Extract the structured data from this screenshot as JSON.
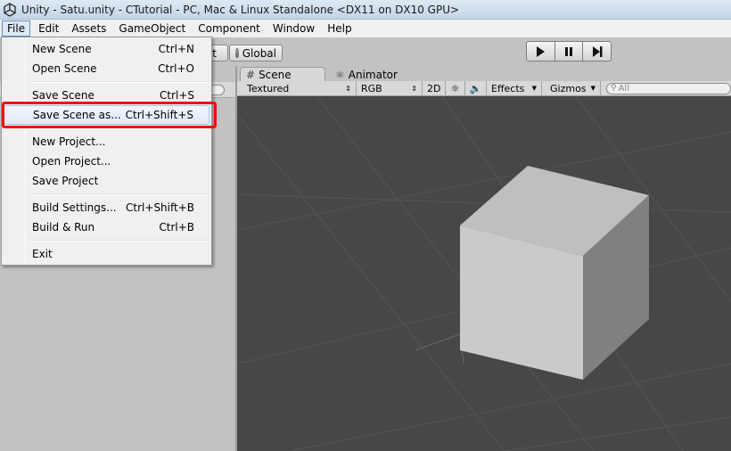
{
  "window": {
    "title": "Unity - Satu.unity - CTutorial - PC, Mac & Linux Standalone <DX11 on DX10 GPU>"
  },
  "menubar": {
    "items": [
      "File",
      "Edit",
      "Assets",
      "GameObject",
      "Component",
      "Window",
      "Help"
    ],
    "active": "File"
  },
  "toolbar": {
    "pivot_label": "ot",
    "global_label": "Global",
    "play_icon": "play-icon",
    "pause_icon": "pause-icon",
    "step_icon": "step-icon"
  },
  "tabs": {
    "scene": "Scene",
    "animator": "Animator"
  },
  "scene_controls": {
    "render_mode": "Textured",
    "color_mode": "RGB",
    "toggle_2d": "2D",
    "lighting_icon": "sun-icon",
    "audio_icon": "speaker-icon",
    "effects": "Effects",
    "gizmos": "Gizmos",
    "search_placeholder": "All"
  },
  "file_menu": {
    "items": [
      {
        "label": "New Scene",
        "shortcut": "Ctrl+N"
      },
      {
        "label": "Open Scene",
        "shortcut": "Ctrl+O"
      },
      {
        "label": "Save Scene",
        "shortcut": "Ctrl+S"
      },
      {
        "label": "Save Scene as...",
        "shortcut": "Ctrl+Shift+S",
        "highlighted": true
      },
      {
        "label": "New Project...",
        "shortcut": ""
      },
      {
        "label": "Open Project...",
        "shortcut": ""
      },
      {
        "label": "Save Project",
        "shortcut": ""
      },
      {
        "label": "Build Settings...",
        "shortcut": "Ctrl+Shift+B"
      },
      {
        "label": "Build & Run",
        "shortcut": "Ctrl+B"
      },
      {
        "label": "Exit",
        "shortcut": ""
      }
    ]
  },
  "colors": {
    "highlight_border": "#f30b0b",
    "viewport_bg": "#474747",
    "cube_top": "#bfbfbf",
    "cube_front": "#c9caca",
    "cube_right": "#7f8080"
  }
}
